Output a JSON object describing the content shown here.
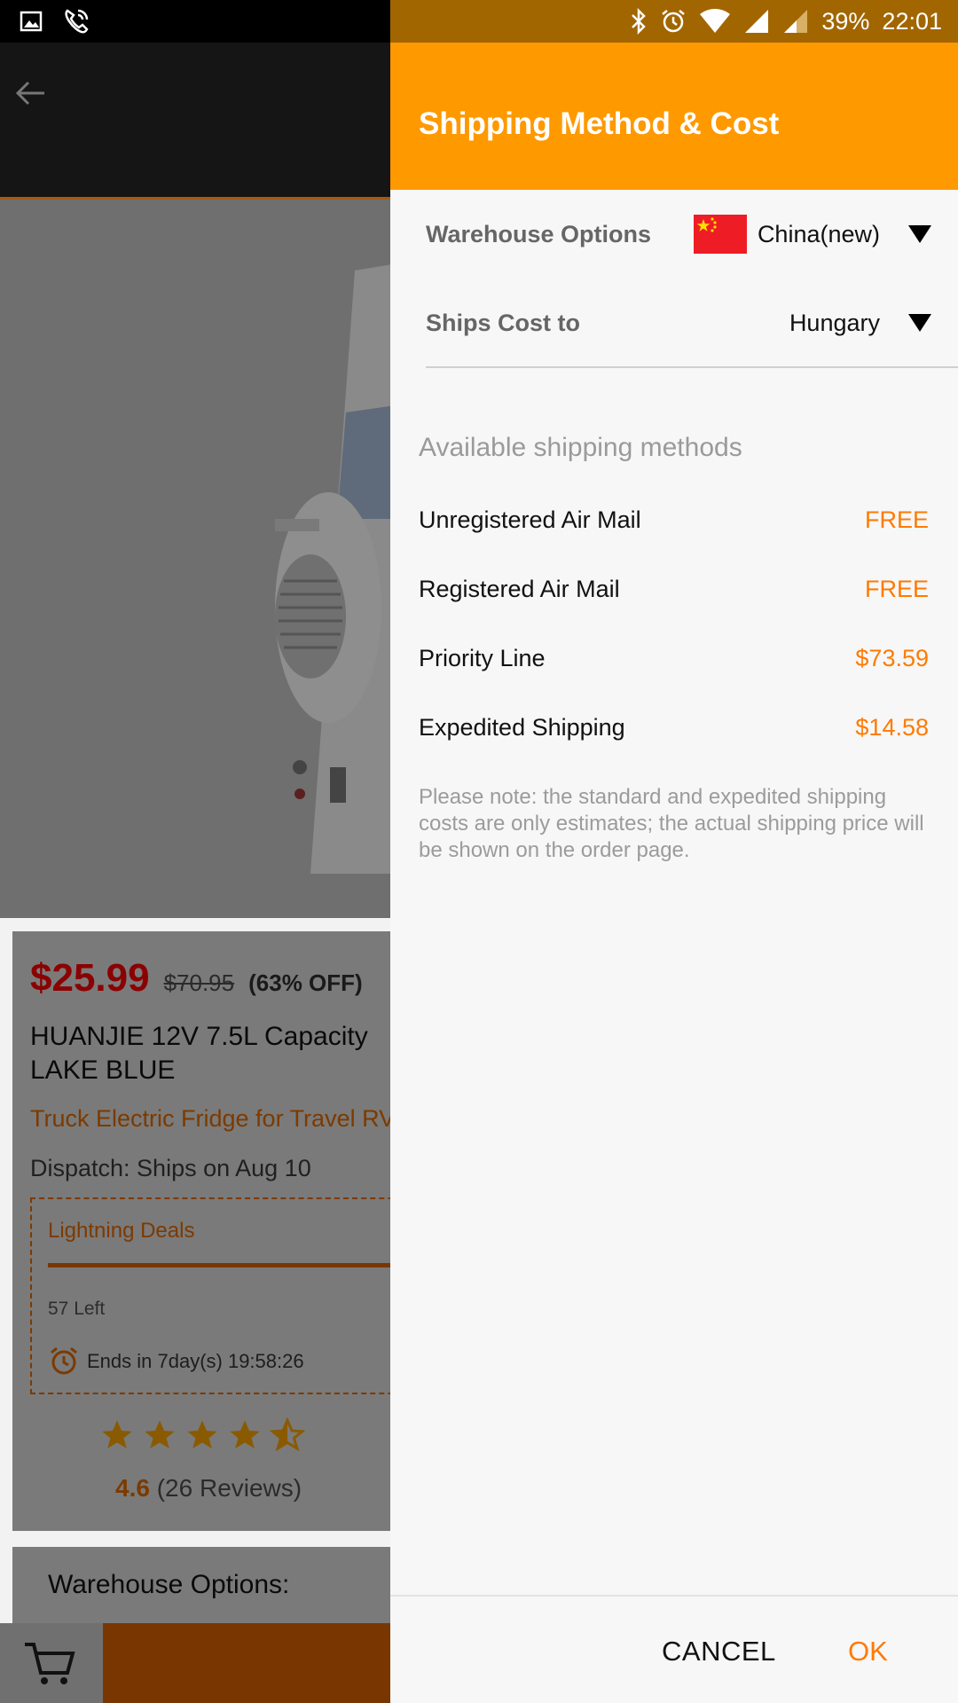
{
  "status_bar": {
    "battery": "39%",
    "time": "22:01"
  },
  "product": {
    "price": "$25.99",
    "original_price": "$70.95",
    "discount": "(63% OFF)",
    "title": "HUANJIE 12V 7.5L Capacity LAKE BLUE",
    "subtitle": "Truck Electric Fridge for Travel RV",
    "dispatch": "Dispatch: Ships on Aug 10",
    "deals": {
      "title": "Lightning Deals",
      "left": "57 Left",
      "ends": "Ends in 7day(s) 19:58:26"
    },
    "rating": {
      "value": "4.6",
      "reviews": "(26 Reviews)",
      "stars": 4.5
    },
    "warehouse_label": "Warehouse Options:"
  },
  "drawer": {
    "title": "Shipping Method & Cost",
    "warehouse": {
      "label": "Warehouse Options",
      "value": "China(new)"
    },
    "ships_to": {
      "label": "Ships Cost to",
      "value": "Hungary"
    },
    "available_title": "Available shipping methods",
    "methods": [
      {
        "name": "Unregistered Air Mail",
        "cost": "FREE"
      },
      {
        "name": "Registered Air Mail",
        "cost": "FREE"
      },
      {
        "name": "Priority Line",
        "cost": "$73.59"
      },
      {
        "name": "Expedited Shipping",
        "cost": "$14.58"
      }
    ],
    "note": "Please note: the standard and expedited shipping costs are only estimates; the actual shipping price will be shown on the order page.",
    "cancel_label": "CANCEL",
    "ok_label": "OK"
  },
  "colors": {
    "accent": "#ff9900",
    "cost": "#ff7a00",
    "price": "#8b0000"
  }
}
